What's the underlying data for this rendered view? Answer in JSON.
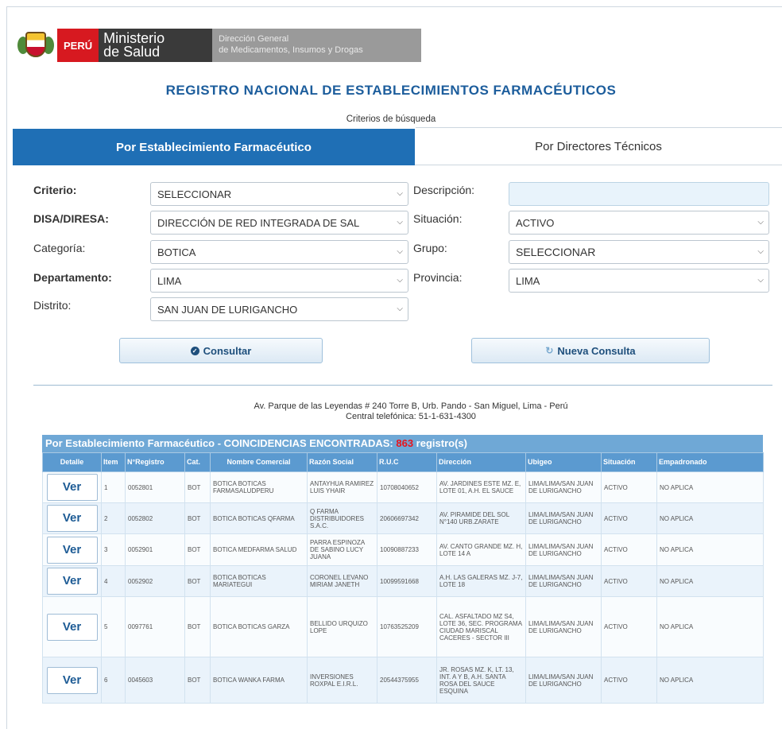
{
  "header": {
    "peru": "PERÚ",
    "ministerio_l1": "Ministerio",
    "ministerio_l2": "de Salud",
    "direccion_l1": "Dirección General",
    "direccion_l2": "de Medicamentos, Insumos y Drogas"
  },
  "title": "REGISTRO NACIONAL DE ESTABLECIMIENTOS FARMACÉUTICOS",
  "subtitle": "Criterios de búsqueda",
  "tabs": {
    "active": "Por Establecimiento Farmacéutico",
    "inactive": "Por Directores Técnicos"
  },
  "form": {
    "criterio_label": "Criterio:",
    "criterio_value": "SELECCIONAR",
    "disa_label": "DISA/DIRESA:",
    "disa_value": "DIRECCIÓN DE RED INTEGRADA DE SAL",
    "categoria_label": "Categoría:",
    "categoria_value": "BOTICA",
    "departamento_label": "Departamento:",
    "departamento_value": "LIMA",
    "distrito_label": "Distrito:",
    "distrito_value": "SAN JUAN DE LURIGANCHO",
    "descripcion_label": "Descripción:",
    "situacion_label": "Situación:",
    "situacion_value": "ACTIVO",
    "grupo_label": "Grupo:",
    "grupo_value": "SELECCIONAR",
    "provincia_label": "Provincia:",
    "provincia_value": "LIMA"
  },
  "buttons": {
    "consultar": "Consultar",
    "nueva": "Nueva Consulta"
  },
  "footer": {
    "address": "Av. Parque de las Leyendas # 240 Torre B, Urb. Pando - San Miguel, Lima - Perú",
    "phone": "Central telefónica: 51-1-631-4300"
  },
  "results": {
    "prefix": "Por Establecimiento Farmacéutico - COINCIDENCIAS ENCONTRADAS: ",
    "count": "863",
    "suffix": " registro(s)",
    "columns": [
      "Detalle",
      "Item",
      "N°Registro",
      "Cat.",
      "Nombre Comercial",
      "Razón Social",
      "R.U.C",
      "Dirección",
      "Ubigeo",
      "Situación",
      "Empadronado"
    ],
    "ver_label": "Ver",
    "rows": [
      {
        "item": "1",
        "registro": "0052801",
        "cat": "BOT",
        "nombre": "BOTICA BOTICAS FARMASALUDPERU",
        "razon": "ANTAYHUA RAMIREZ LUIS YHAIR",
        "ruc": "10708040652",
        "direccion": "AV. JARDINES ESTE MZ. E, LOTE 01, A.H. EL SAUCE",
        "ubigeo": "LIMA/LIMA/SAN JUAN DE LURIGANCHO",
        "situacion": "ACTIVO",
        "empadronado": "NO APLICA"
      },
      {
        "item": "2",
        "registro": "0052802",
        "cat": "BOT",
        "nombre": "BOTICA BOTICAS QFARMA",
        "razon": "Q FARMA DISTRIBUIDORES S.A.C.",
        "ruc": "20606697342",
        "direccion": "AV. PIRAMIDE DEL SOL N°140 URB.ZARATE",
        "ubigeo": "LIMA/LIMA/SAN JUAN DE LURIGANCHO",
        "situacion": "ACTIVO",
        "empadronado": "NO APLICA"
      },
      {
        "item": "3",
        "registro": "0052901",
        "cat": "BOT",
        "nombre": "BOTICA MEDFARMA SALUD",
        "razon": "PARRA ESPINOZA DE SABINO LUCY JUANA",
        "ruc": "10090887233",
        "direccion": "AV. CANTO GRANDE MZ. H, LOTE 14 A",
        "ubigeo": "LIMA/LIMA/SAN JUAN DE LURIGANCHO",
        "situacion": "ACTIVO",
        "empadronado": "NO APLICA"
      },
      {
        "item": "4",
        "registro": "0052902",
        "cat": "BOT",
        "nombre": "BOTICA BOTICAS MARIATEGUI",
        "razon": "CORONEL LEVANO MIRIAM JANETH",
        "ruc": "10099591668",
        "direccion": "A.H. LAS GALERAS MZ. J-7, LOTE 18",
        "ubigeo": "LIMA/LIMA/SAN JUAN DE LURIGANCHO",
        "situacion": "ACTIVO",
        "empadronado": "NO APLICA"
      },
      {
        "item": "5",
        "registro": "0097761",
        "cat": "BOT",
        "nombre": "BOTICA BOTICAS GARZA",
        "razon": "BELLIDO URQUIZO LOPE",
        "ruc": "10763525209",
        "direccion": "CAL. ASFALTADO MZ S4, LOTE 36, SEC. PROGRAMA CIUDAD MARISCAL CACERES - SECTOR III",
        "ubigeo": "LIMA/LIMA/SAN JUAN DE LURIGANCHO",
        "situacion": "ACTIVO",
        "empadronado": "NO APLICA"
      },
      {
        "item": "6",
        "registro": "0045603",
        "cat": "BOT",
        "nombre": "BOTICA WANKA FARMA",
        "razon": "INVERSIONES ROXPAL E.I.R.L.",
        "ruc": "20544375955",
        "direccion": "JR. ROSAS MZ. K, LT. 13, INT. A Y B, A.H. SANTA ROSA DEL SAUCE ESQUINA",
        "ubigeo": "LIMA/LIMA/SAN JUAN DE LURIGANCHO",
        "situacion": "ACTIVO",
        "empadronado": "NO APLICA"
      }
    ]
  }
}
